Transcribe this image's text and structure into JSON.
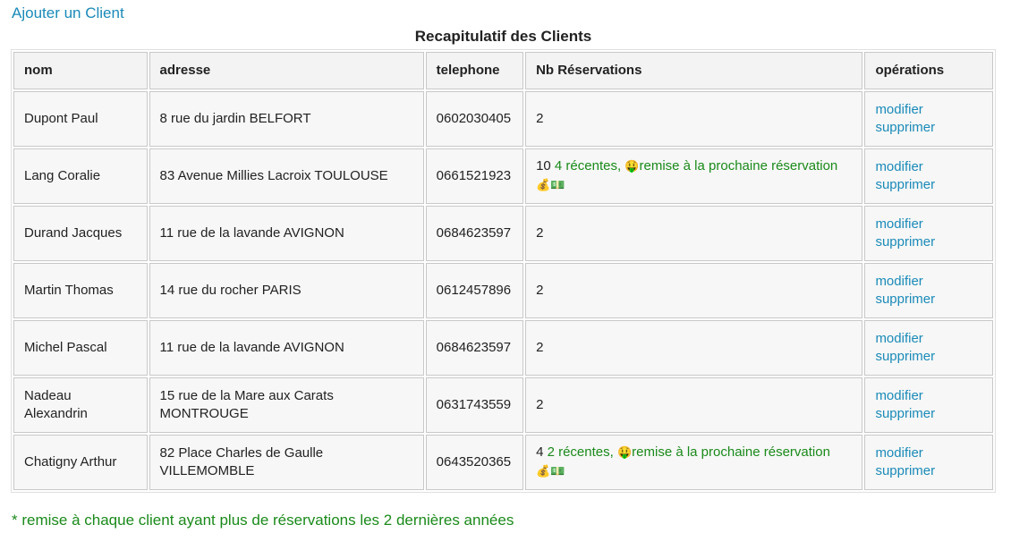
{
  "add_client_link": "Ajouter un Client",
  "table_title": "Recapitulatif des Clients",
  "columns": [
    "nom",
    "adresse",
    "telephone",
    "Nb Réservations",
    "opérations"
  ],
  "rows": [
    {
      "nom": "Dupont Paul",
      "adresse": "8 rue du jardin BELFORT",
      "telephone": "0602030405",
      "nb": "2",
      "promo": null
    },
    {
      "nom": "Lang Coralie",
      "adresse": "83 Avenue Millies Lacroix TOULOUSE",
      "telephone": "0661521923",
      "nb": "10",
      "promo": {
        "recent": "4 récentes,",
        "emoji_face": "🤑",
        "text": "remise à la prochaine réservation",
        "emoji_end": "💰💵"
      }
    },
    {
      "nom": "Durand Jacques",
      "adresse": "11 rue de la lavande AVIGNON",
      "telephone": "0684623597",
      "nb": "2",
      "promo": null
    },
    {
      "nom": "Martin Thomas",
      "adresse": "14 rue du rocher PARIS",
      "telephone": "0612457896",
      "nb": "2",
      "promo": null
    },
    {
      "nom": "Michel Pascal",
      "adresse": "11 rue de la lavande AVIGNON",
      "telephone": "0684623597",
      "nb": "2",
      "promo": null
    },
    {
      "nom": "Nadeau Alexandrin",
      "adresse": "15 rue de la Mare aux Carats MONTROUGE",
      "telephone": "0631743559",
      "nb": "2",
      "promo": null
    },
    {
      "nom": "Chatigny Arthur",
      "adresse": "82 Place Charles de Gaulle VILLEMOMBLE",
      "telephone": "0643520365",
      "nb": "4",
      "promo": {
        "recent": "2 récentes,",
        "emoji_face": "🤑",
        "text": "remise à la prochaine réservation",
        "emoji_end": "💰💵"
      }
    }
  ],
  "operations": {
    "modify": "modifier",
    "delete": "supprimer"
  },
  "footnote": "* remise à chaque client ayant plus de réservations les 2 dernières années",
  "colors": {
    "link": "#1a8ab8",
    "promo": "#1a8a1a"
  }
}
